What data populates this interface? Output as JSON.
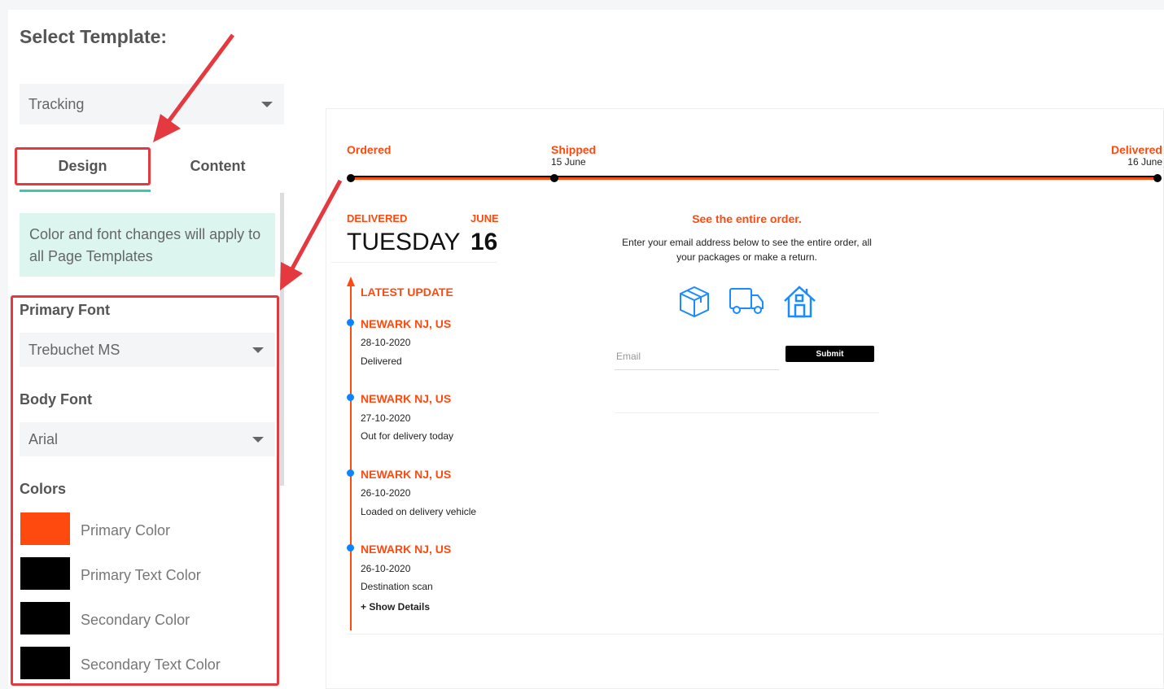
{
  "sidebar": {
    "title": "Select Template:",
    "template_select": "Tracking",
    "tabs": [
      {
        "label": "Design",
        "active": true
      },
      {
        "label": "Content",
        "active": false
      }
    ],
    "note": "Color and font changes will apply to all Page Templates",
    "primary_font_label": "Primary Font",
    "primary_font": "Trebuchet MS",
    "body_font_label": "Body Font",
    "body_font": "Arial",
    "colors_label": "Colors",
    "colors": [
      {
        "label": "Primary Color",
        "value": "#ff4a0f"
      },
      {
        "label": "Primary Text Color",
        "value": "#000000"
      },
      {
        "label": "Secondary Color",
        "value": "#000000"
      },
      {
        "label": "Secondary Text Color",
        "value": "#000000"
      }
    ]
  },
  "preview": {
    "progress": [
      {
        "label": "Ordered",
        "date": ""
      },
      {
        "label": "Shipped",
        "date": "15 June"
      },
      {
        "label": "Delivered",
        "date": "16 June"
      }
    ],
    "status": "DELIVERED",
    "month": "JUNE",
    "weekday": "TUESDAY",
    "day": "16",
    "latest_update": "LATEST UPDATE",
    "events": [
      {
        "location": "NEWARK NJ, US",
        "date": "28-10-2020",
        "desc": "Delivered"
      },
      {
        "location": "NEWARK NJ, US",
        "date": "27-10-2020",
        "desc": "Out for delivery today"
      },
      {
        "location": "NEWARK NJ, US",
        "date": "26-10-2020",
        "desc": "Loaded on delivery vehicle"
      },
      {
        "location": "NEWARK NJ, US",
        "date": "26-10-2020",
        "desc": "Destination scan"
      }
    ],
    "show_details": "+ Show Details",
    "order_title": "See the entire order.",
    "order_text": "Enter your email address below to see the entire order, all your packages or make a return.",
    "email_placeholder": "Email",
    "submit": "Submit",
    "icons": [
      "package-icon",
      "truck-icon",
      "home-icon"
    ]
  },
  "colors": {
    "primary": "#ff4a0f",
    "accent": "#3cc8aa",
    "annotation": "#e53940",
    "icon": "#1a8cff"
  }
}
